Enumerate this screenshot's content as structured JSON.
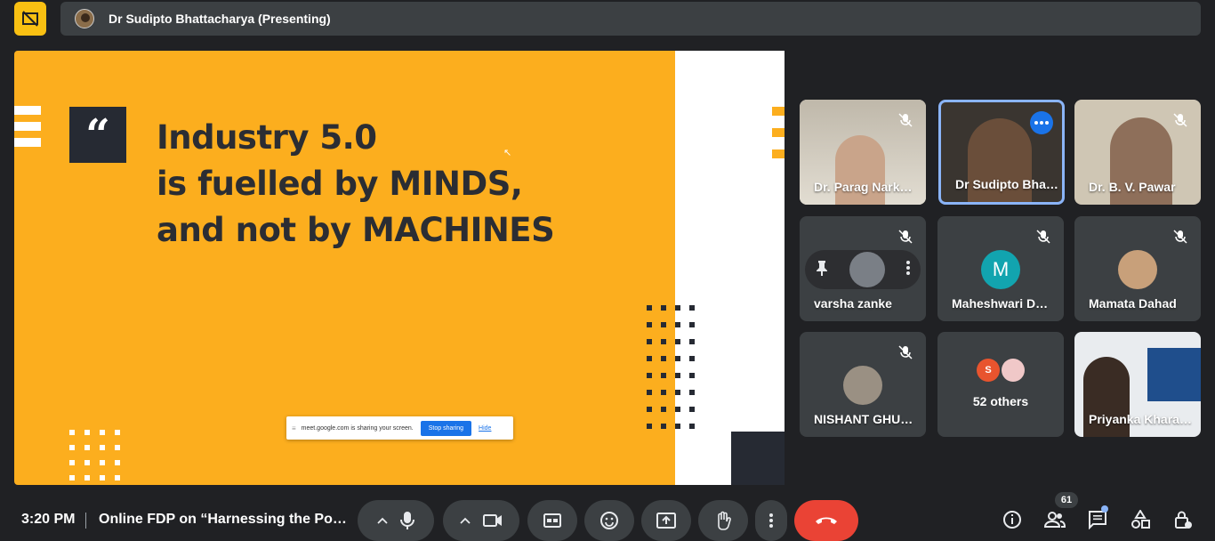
{
  "presenter": {
    "name": "Dr Sudipto Bhattacharya (Presenting)"
  },
  "slide": {
    "quote_mark": "“",
    "line1": "Industry 5.0",
    "line2": "is fuelled by MINDS,",
    "line3": "and not by MACHINES"
  },
  "share_popup": {
    "text": "meet.google.com is sharing your screen.",
    "stop_label": "Stop sharing",
    "hide_label": "Hide"
  },
  "participants": [
    {
      "name": "Dr. Parag Nark…"
    },
    {
      "name": "Dr Sudipto Bha…"
    },
    {
      "name": "Dr. B. V. Pawar"
    },
    {
      "name": "varsha zanke"
    },
    {
      "name": "Maheshwari D…",
      "initial": "M"
    },
    {
      "name": "Mamata Dahad"
    },
    {
      "name": "NISHANT GHU…"
    },
    {
      "name": "52 others",
      "initial": "S"
    },
    {
      "name": "Priyanka Khara…"
    }
  ],
  "bottom": {
    "time": "3:20 PM",
    "meeting_title": "Online FDP on “Harnessing the Po…",
    "people_count": "61"
  },
  "colors": {
    "accent": "#1a73e8",
    "slide_bg": "#fcae1e",
    "end_call": "#ea4335"
  }
}
